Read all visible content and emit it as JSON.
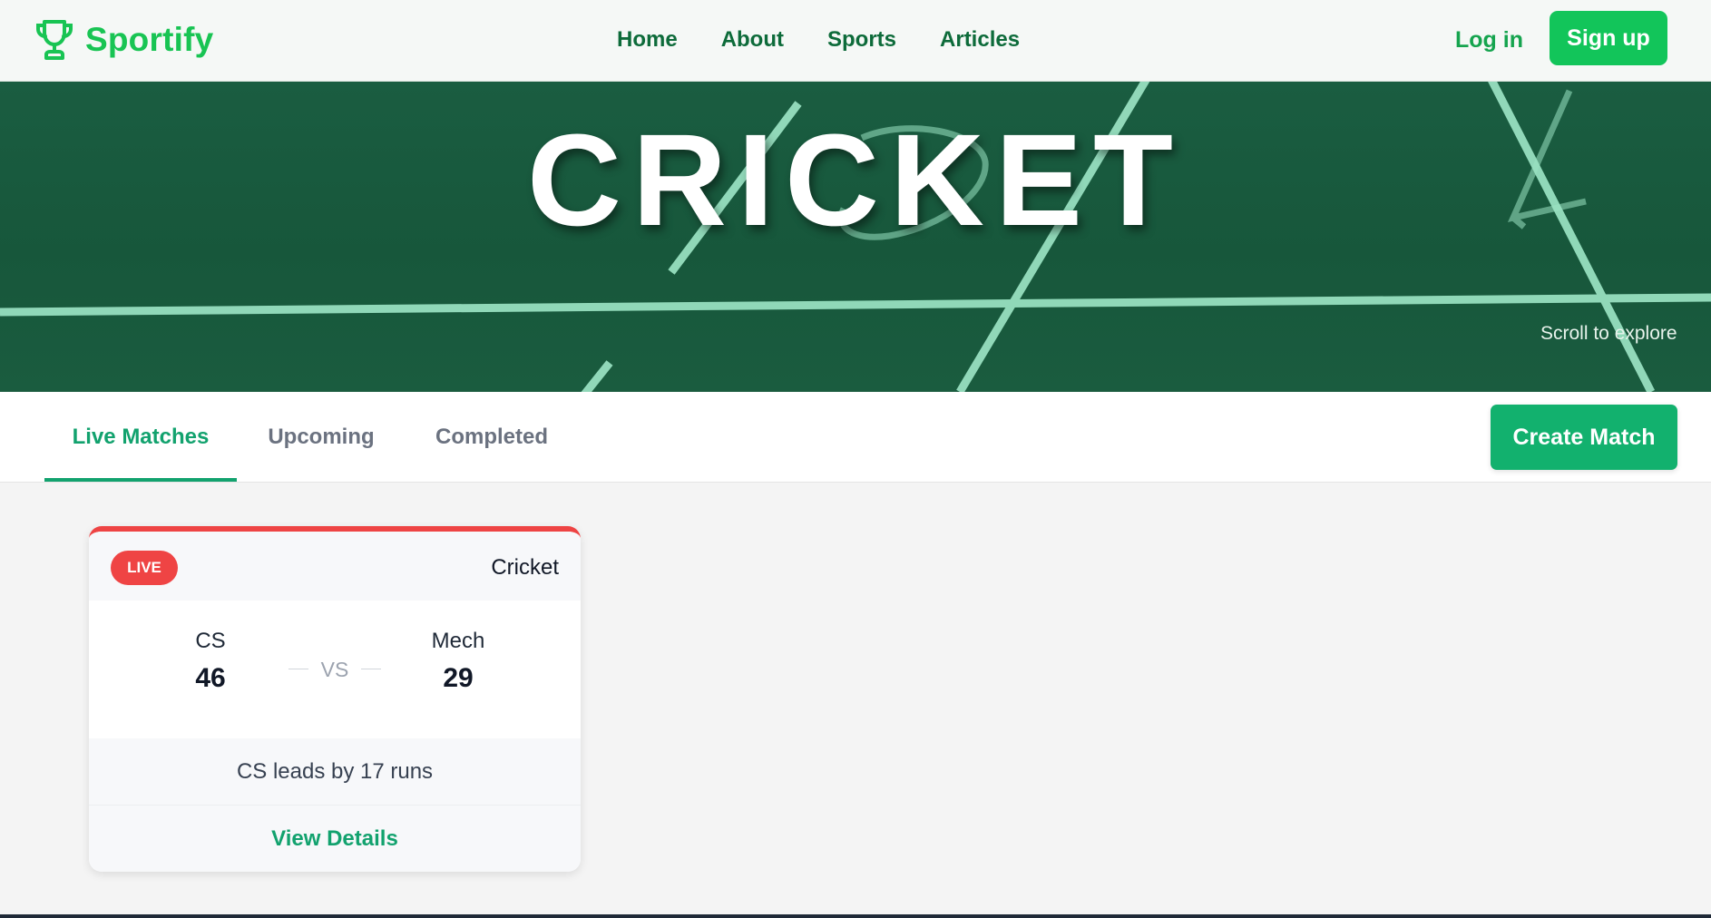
{
  "brand": {
    "name": "Sportify",
    "icon": "trophy-icon",
    "color": "#18c453"
  },
  "nav": {
    "links": [
      "Home",
      "About",
      "Sports",
      "Articles"
    ],
    "login_label": "Log in",
    "signup_label": "Sign up"
  },
  "hero": {
    "title": "CRICKET",
    "scroll_hint": "Scroll to explore"
  },
  "tabs": {
    "items": [
      "Live Matches",
      "Upcoming",
      "Completed"
    ],
    "active": "Live Matches",
    "create_label": "Create Match"
  },
  "match": {
    "badge": "LIVE",
    "sport": "Cricket",
    "team_a": {
      "name": "CS",
      "score": "46"
    },
    "vs": "VS",
    "team_b": {
      "name": "Mech",
      "score": "29"
    },
    "status": "CS leads by 17 runs",
    "details_label": "View Details"
  },
  "colors": {
    "accent": "#12a26e",
    "live": "#ef4444",
    "hero_bg": "#17573b"
  }
}
